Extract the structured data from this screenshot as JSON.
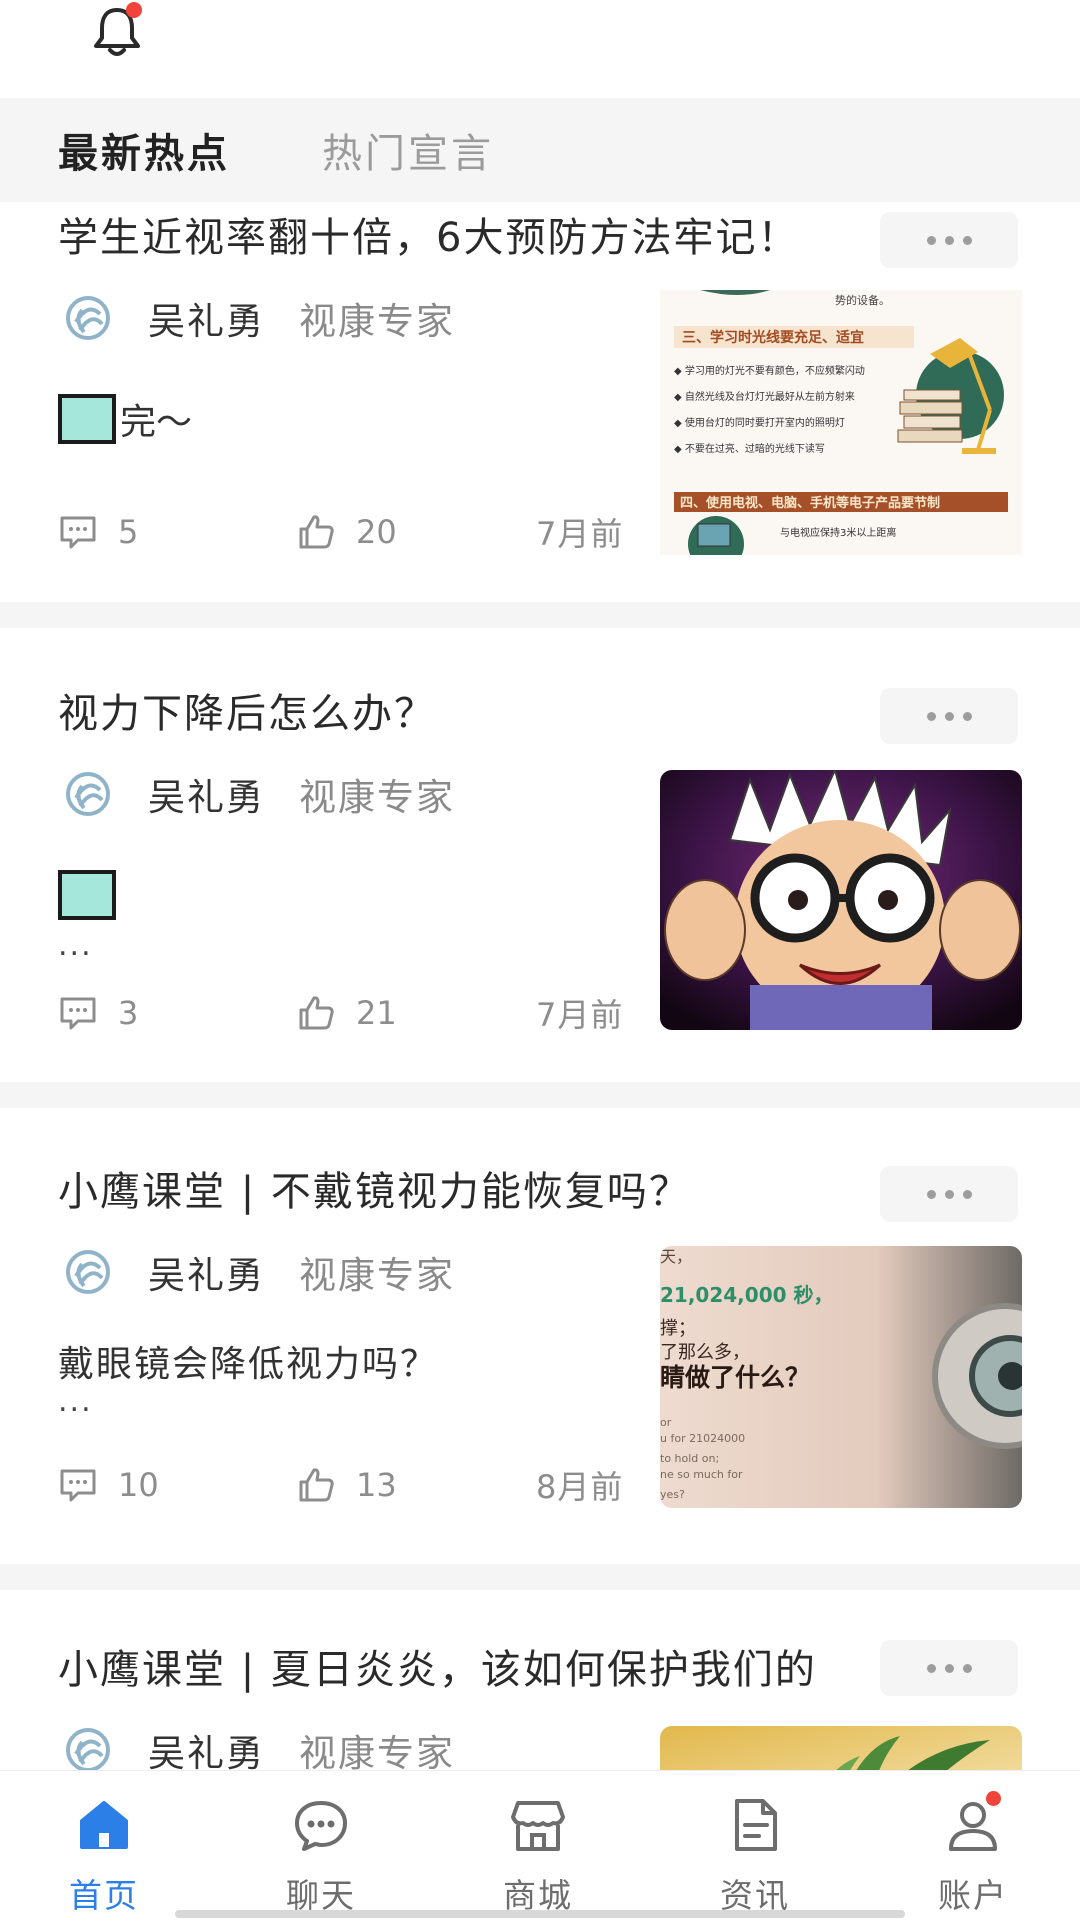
{
  "tabs": [
    {
      "label": "最新热点",
      "active": true
    },
    {
      "label": "热门宣言",
      "active": false
    }
  ],
  "posts": [
    {
      "title": "学生近视率翻十倍，6大预防方法牢记！",
      "author": "吴礼勇",
      "role": "视康专家",
      "excerpt": "完～",
      "comments": "5",
      "likes": "20",
      "time": "7月前",
      "image_text": {
        "line1": "势的设备。",
        "section3": "三、学习时光线要充足、适宜",
        "bullets": [
          "学习用的灯光不要有颜色，不应频繁闪动",
          "自然光线及台灯灯光最好从左前方射来",
          "使用台灯的同时要打开室内的照明灯",
          "不要在过亮、过暗的光线下读写"
        ],
        "section4": "四、使用电视、电脑、手机等电子产品要节制",
        "line_tv": "与电视应保持3米以上距离"
      }
    },
    {
      "title": "视力下降后怎么办？",
      "author": "吴礼勇",
      "role": "视康专家",
      "excerpt": "",
      "ellipsis": "...",
      "comments": "3",
      "likes": "21",
      "time": "7月前"
    },
    {
      "title": "小鹰课堂 | 不戴镜视力能恢复吗？",
      "author": "吴礼勇",
      "role": "视康专家",
      "excerpt": "戴眼镜会降低视力吗？",
      "ellipsis": "...",
      "comments": "10",
      "likes": "13",
      "time": "8月前",
      "image_text": {
        "line1": "天，",
        "line2": "21,024,000 秒，",
        "line3": "撑；",
        "line4": "了那么多，",
        "line5": "睛做了什么？",
        "line6": "or",
        "line7": "u for 21024000",
        "line8": "to hold on;",
        "line9": "ne so much for",
        "line10": "yes?"
      }
    },
    {
      "title": "小鹰课堂 | 夏日炎炎，该如何保护我们的",
      "author": "吴礼勇",
      "role": "视康专家"
    }
  ],
  "nav": [
    {
      "label": "首页",
      "icon": "home-icon",
      "active": true
    },
    {
      "label": "聊天",
      "icon": "chat-icon",
      "active": false
    },
    {
      "label": "商城",
      "icon": "store-icon",
      "active": false
    },
    {
      "label": "资讯",
      "icon": "document-icon",
      "active": false
    },
    {
      "label": "账户",
      "icon": "user-icon",
      "active": false,
      "badge": true
    }
  ],
  "colors": {
    "accent": "#2d7fe8",
    "badge": "#f0443a",
    "placeholder_square": "#a6e7dc"
  }
}
